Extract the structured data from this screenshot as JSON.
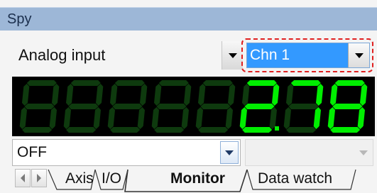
{
  "panel": {
    "title": "Spy"
  },
  "source_select": {
    "selected": "Analog input",
    "icon": "chevron-down-icon"
  },
  "channel_select": {
    "selected": "Chn 1",
    "icon": "chevron-down-icon"
  },
  "display": {
    "value": "2.78",
    "lit_color": "#00ee00",
    "unlit_color": "#0e3a0e",
    "background_color": "#000000"
  },
  "mode_select": {
    "selected": "OFF",
    "icon": "chevron-down-icon"
  },
  "secondary_select": {
    "selected": "",
    "disabled": true,
    "icon": "chevron-down-icon"
  },
  "tabs": {
    "items": [
      {
        "label": "Axis",
        "active": false
      },
      {
        "label": "I/O",
        "active": false
      },
      {
        "label": "Monitor",
        "active": true
      },
      {
        "label": "Data watch",
        "active": false
      }
    ],
    "nav_icons": [
      "chevron-left-icon",
      "chevron-right-icon"
    ]
  },
  "colors": {
    "titlebar": "#9db7d7",
    "selection": "#3399ff",
    "highlight_outline": "#e02020"
  }
}
